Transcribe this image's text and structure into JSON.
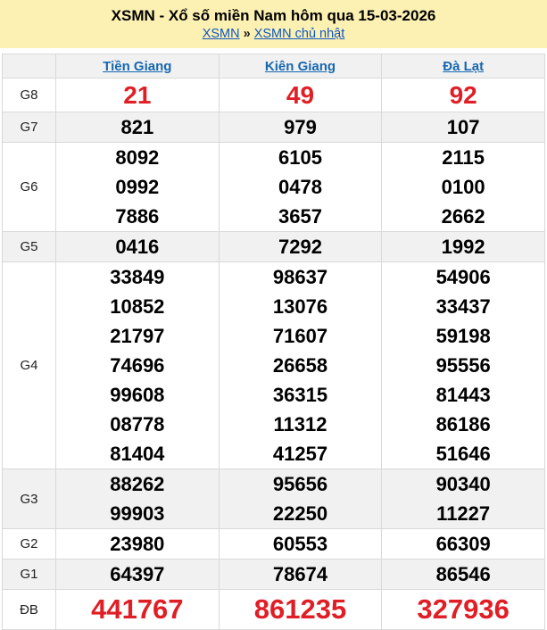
{
  "colors": {
    "banner-yellow": "#fcf0b2",
    "link-blue": "#0d57c4",
    "province-blue": "#1767b1",
    "number-red": "#e01e25",
    "row-shade": "#f1f1f1",
    "border-gray": "#d9d9d9"
  },
  "header": {
    "title": "XSMN - Xổ số miền Nam hôm qua 15-03-2026",
    "breadcrumb": {
      "link1": "XSMN",
      "separator": "»",
      "link2": "XSMN chủ nhật"
    }
  },
  "table": {
    "provinces": [
      "Tiền Giang",
      "Kiên Giang",
      "Đà Lạt"
    ],
    "rows": [
      {
        "key": "g8",
        "label": "G8",
        "highlight": true,
        "cells": [
          [
            "21"
          ],
          [
            "49"
          ],
          [
            "92"
          ]
        ]
      },
      {
        "key": "g7",
        "label": "G7",
        "highlight": false,
        "cells": [
          [
            "821"
          ],
          [
            "979"
          ],
          [
            "107"
          ]
        ]
      },
      {
        "key": "g6",
        "label": "G6",
        "highlight": false,
        "cells": [
          [
            "8092",
            "0992",
            "7886"
          ],
          [
            "6105",
            "0478",
            "3657"
          ],
          [
            "2115",
            "0100",
            "2662"
          ]
        ]
      },
      {
        "key": "g5",
        "label": "G5",
        "highlight": false,
        "cells": [
          [
            "0416"
          ],
          [
            "7292"
          ],
          [
            "1992"
          ]
        ]
      },
      {
        "key": "g4",
        "label": "G4",
        "highlight": false,
        "cells": [
          [
            "33849",
            "10852",
            "21797",
            "74696",
            "99608",
            "08778",
            "81404"
          ],
          [
            "98637",
            "13076",
            "71607",
            "26658",
            "36315",
            "11312",
            "41257"
          ],
          [
            "54906",
            "33437",
            "59198",
            "95556",
            "81443",
            "86186",
            "51646"
          ]
        ]
      },
      {
        "key": "g3",
        "label": "G3",
        "highlight": false,
        "cells": [
          [
            "88262",
            "99903"
          ],
          [
            "95656",
            "22250"
          ],
          [
            "90340",
            "11227"
          ]
        ]
      },
      {
        "key": "g2",
        "label": "G2",
        "highlight": false,
        "cells": [
          [
            "23980"
          ],
          [
            "60553"
          ],
          [
            "66309"
          ]
        ]
      },
      {
        "key": "g1",
        "label": "G1",
        "highlight": false,
        "cells": [
          [
            "64397"
          ],
          [
            "78674"
          ],
          [
            "86546"
          ]
        ]
      },
      {
        "key": "db",
        "label": "ĐB",
        "highlight": true,
        "cells": [
          [
            "441767"
          ],
          [
            "861235"
          ],
          [
            "327936"
          ]
        ]
      }
    ]
  }
}
